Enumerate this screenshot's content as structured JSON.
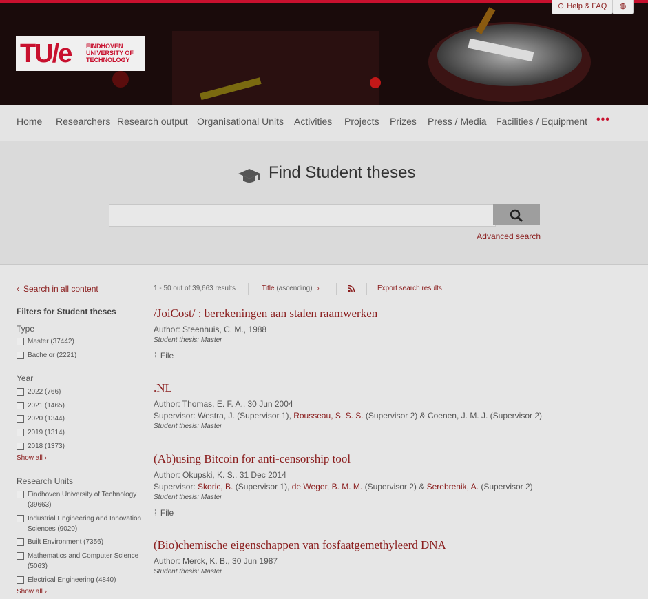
{
  "header": {
    "help_label": "Help & FAQ",
    "logo": {
      "main": "TU/e",
      "line1": "EINDHOVEN",
      "line2": "UNIVERSITY OF",
      "line3": "TECHNOLOGY"
    }
  },
  "nav": {
    "items": [
      "Home",
      "Researchers",
      "Research output",
      "Organisational Units",
      "Activities",
      "Projects",
      "Prizes",
      "Press / Media",
      "Facilities / Equipment"
    ],
    "more": "•••"
  },
  "search": {
    "title": "Find Student theses",
    "placeholder": "",
    "advanced": "Advanced search"
  },
  "sidebar": {
    "back": "Search in all content",
    "heading": "Filters for Student theses",
    "groups": [
      {
        "label": "Type",
        "options": [
          "Master (37442)",
          "Bachelor (2221)"
        ]
      },
      {
        "label": "Year",
        "options": [
          "2022 (766)",
          "2021 (1465)",
          "2020 (1344)",
          "2019 (1314)",
          "2018 (1373)"
        ],
        "show_all": "Show all ›"
      },
      {
        "label": "Research Units",
        "options": [
          "Eindhoven University of Technology (39663)",
          "Industrial Engineering and Innovation Sciences (9020)",
          "Built Environment (7356)",
          "Mathematics and Computer Science (5063)",
          "Electrical Engineering (4840)"
        ],
        "show_all": "Show all ›"
      }
    ]
  },
  "results_bar": {
    "count": "1 - 50 out of 39,663 results",
    "sort_label": "Title",
    "sort_order": "(ascending)",
    "export": "Export search results"
  },
  "results": [
    {
      "title": "/JoiCost/ : berekeningen aan stalen raamwerken",
      "author": "Author: Steenhuis, C. M., 1988",
      "type": "Student thesis: Master",
      "file": "File"
    },
    {
      "title": ".NL",
      "author": "Author: Thomas, E. F. A., 30 Jun 2004",
      "supervisor": {
        "prefix": "Supervisor: Westra, J. (Supervisor 1), ",
        "link1": "Rousseau, S. S. S.",
        "mid": " (Supervisor 2) & Coenen, J. M. J. (Supervisor 2)"
      },
      "type": "Student thesis: Master"
    },
    {
      "title": "(Ab)using Bitcoin for anti-censorship tool",
      "author": "Author: Okupski, K. S., 31 Dec 2014",
      "supervisor": {
        "prefix": "Supervisor: ",
        "link1": "Skoric, B.",
        "mid1": " (Supervisor 1), ",
        "link2": "de Weger, B. M. M.",
        "mid2": " (Supervisor 2) & ",
        "link3": "Serebrenik, A.",
        "suffix": " (Supervisor 2)"
      },
      "type": "Student thesis: Master",
      "file": "File"
    },
    {
      "title": "(Bio)chemische eigenschappen van fosfaatgemethyleerd DNA",
      "author": "Author: Merck, K. B., 30 Jun 1987",
      "type": "Student thesis: Master"
    }
  ],
  "colors": {
    "brand": "#c8102e",
    "link": "#8a1d1d"
  }
}
